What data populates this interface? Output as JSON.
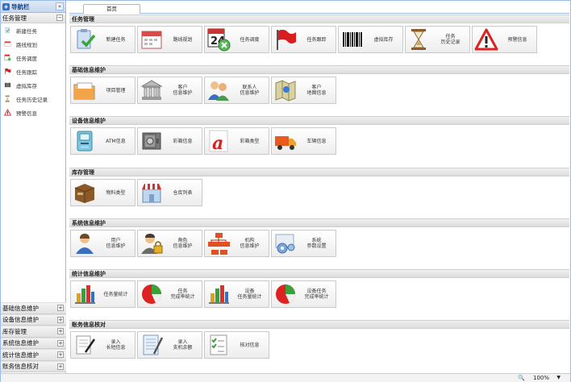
{
  "nav": {
    "title": "导航栏",
    "collapse_label": "«",
    "open_group": {
      "label": "任务管理",
      "toggle": "−",
      "items": [
        {
          "label": "新建任务",
          "icon": "new-task-icon"
        },
        {
          "label": "路线规划",
          "icon": "route-plan-icon"
        },
        {
          "label": "任务调度",
          "icon": "task-dispatch-icon"
        },
        {
          "label": "任务跟踪",
          "icon": "flag-icon"
        },
        {
          "label": "虚拟库存",
          "icon": "barcode-icon"
        },
        {
          "label": "任务历史记录",
          "icon": "hourglass-icon"
        },
        {
          "label": "预警信息",
          "icon": "warning-icon"
        }
      ]
    },
    "collapsed_groups": [
      {
        "label": "基础信息维护",
        "toggle": "+"
      },
      {
        "label": "设备信息维护",
        "toggle": "+"
      },
      {
        "label": "库存管理",
        "toggle": "+"
      },
      {
        "label": "系统信息维护",
        "toggle": "+"
      },
      {
        "label": "统计信息维护",
        "toggle": "+"
      },
      {
        "label": "账务信息核对",
        "toggle": "+"
      }
    ]
  },
  "tabs": [
    {
      "label": "首页"
    }
  ],
  "sections": [
    {
      "title": "任务管理",
      "tiles": [
        {
          "label": "新建任务",
          "icon": "clipboard-check-icon"
        },
        {
          "label": "路线规划",
          "icon": "calendar-icon"
        },
        {
          "label": "任务调度",
          "icon": "calendar-clock-icon"
        },
        {
          "label": "任务跟踪",
          "icon": "flag-icon"
        },
        {
          "label": "虚拟库存",
          "icon": "barcode-icon"
        },
        {
          "label": "任务\n历史记录",
          "icon": "hourglass-icon"
        },
        {
          "label": "预警信息",
          "icon": "warning-icon"
        }
      ]
    },
    {
      "title": "基础信息维护",
      "tiles": [
        {
          "label": "项目管理",
          "icon": "folder-icon"
        },
        {
          "label": "客户\n信息维护",
          "icon": "bank-icon"
        },
        {
          "label": "联系人\n信息维护",
          "icon": "users-icon"
        },
        {
          "label": "客户\n地图信息",
          "icon": "map-icon"
        }
      ]
    },
    {
      "title": "设备信息维护",
      "tiles": [
        {
          "label": "ATM信息",
          "icon": "atm-icon"
        },
        {
          "label": "彩箱信息",
          "icon": "safe-icon"
        },
        {
          "label": "彩箱类型",
          "icon": "letter-a-icon"
        },
        {
          "label": "车辆信息",
          "icon": "truck-icon"
        }
      ]
    },
    {
      "title": "库存管理",
      "tiles": [
        {
          "label": "物料类型",
          "icon": "box-icon"
        },
        {
          "label": "仓库列表",
          "icon": "store-icon"
        }
      ]
    },
    {
      "title": "系统信息维护",
      "tiles": [
        {
          "label": "用户\n信息维护",
          "icon": "user-icon"
        },
        {
          "label": "角色\n信息维护",
          "icon": "user-lock-icon"
        },
        {
          "label": "机构\n信息维护",
          "icon": "org-chart-icon"
        },
        {
          "label": "系统\n参数设置",
          "icon": "gears-icon"
        }
      ]
    },
    {
      "title": "统计信息维护",
      "tiles": [
        {
          "label": "任务量统计",
          "icon": "bar-chart-icon"
        },
        {
          "label": "任务\n完成率统计",
          "icon": "pie-chart-icon"
        },
        {
          "label": "设备\n任务量统计",
          "icon": "bar-chart-icon"
        },
        {
          "label": "设备任务\n完成率统计",
          "icon": "pie-chart-icon"
        }
      ]
    },
    {
      "title": "账务信息核对",
      "tiles": [
        {
          "label": "录入\n长短信息",
          "icon": "document-pen-icon"
        },
        {
          "label": "录入\n支机余额",
          "icon": "notebook-pen-icon"
        },
        {
          "label": "核对信息",
          "icon": "checklist-icon"
        }
      ]
    }
  ],
  "status": {
    "zoom": "100%",
    "zoom_icon": "zoom-icon"
  }
}
